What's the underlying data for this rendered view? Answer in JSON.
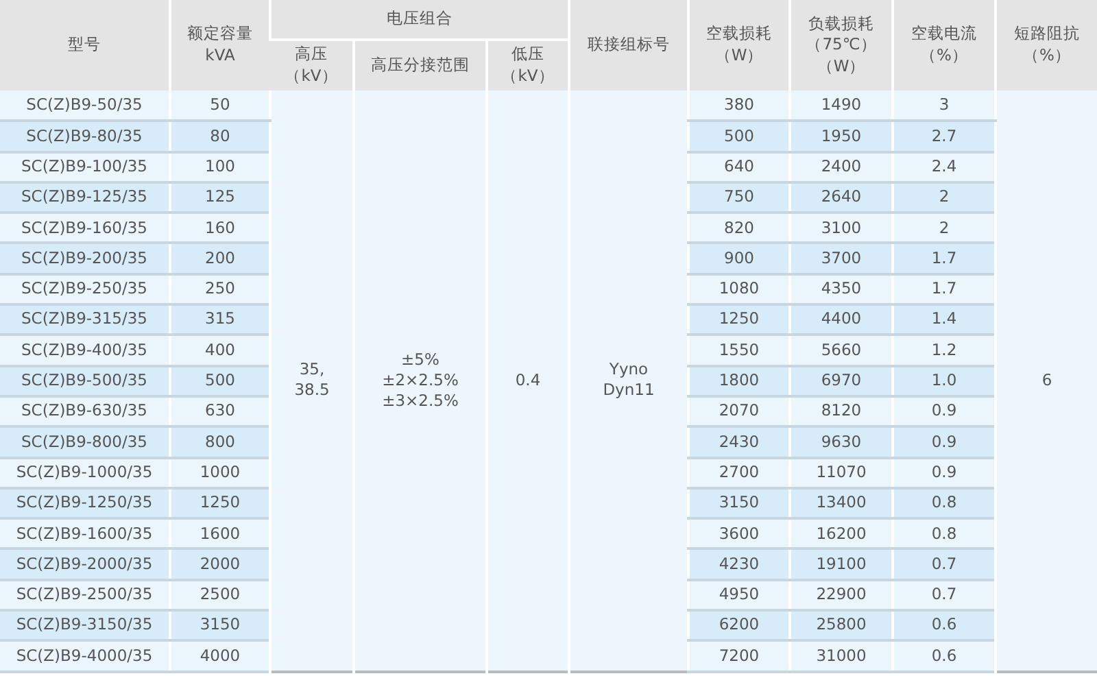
{
  "table": {
    "header": {
      "model": "型号",
      "capacity": "额定容量\nkVA",
      "voltage_group": "电压组合",
      "hv": "高压（kV）",
      "tap_range": "高压分接范围",
      "lv": "低压（kV）",
      "vector_group": "联接组标号",
      "no_load_loss": "空载损耗（W）",
      "load_loss": "负载损耗（75℃）（W）",
      "no_load_current": "空载电流（%）",
      "impedance": "短路阻抗（%）"
    },
    "merged": {
      "hv": "35,\n38.5",
      "tap_range": "±5%\n±2×2.5%\n±3×2.5%",
      "lv": "0.4",
      "vector_group": "Yyno\nDyn11",
      "impedance": "6"
    },
    "rows": [
      {
        "model": "SC(Z)B9-50/35",
        "capacity": "50",
        "no_load_loss": "380",
        "load_loss": "1490",
        "no_load_current": "3"
      },
      {
        "model": "SC(Z)B9-80/35",
        "capacity": "80",
        "no_load_loss": "500",
        "load_loss": "1950",
        "no_load_current": "2.7"
      },
      {
        "model": "SC(Z)B9-100/35",
        "capacity": "100",
        "no_load_loss": "640",
        "load_loss": "2400",
        "no_load_current": "2.4"
      },
      {
        "model": "SC(Z)B9-125/35",
        "capacity": "125",
        "no_load_loss": "750",
        "load_loss": "2640",
        "no_load_current": "2"
      },
      {
        "model": "SC(Z)B9-160/35",
        "capacity": "160",
        "no_load_loss": "820",
        "load_loss": "3100",
        "no_load_current": "2"
      },
      {
        "model": "SC(Z)B9-200/35",
        "capacity": "200",
        "no_load_loss": "900",
        "load_loss": "3700",
        "no_load_current": "1.7"
      },
      {
        "model": "SC(Z)B9-250/35",
        "capacity": "250",
        "no_load_loss": "1080",
        "load_loss": "4350",
        "no_load_current": "1.7"
      },
      {
        "model": "SC(Z)B9-315/35",
        "capacity": "315",
        "no_load_loss": "1250",
        "load_loss": "4400",
        "no_load_current": "1.4"
      },
      {
        "model": "SC(Z)B9-400/35",
        "capacity": "400",
        "no_load_loss": "1550",
        "load_loss": "5660",
        "no_load_current": "1.2"
      },
      {
        "model": "SC(Z)B9-500/35",
        "capacity": "500",
        "no_load_loss": "1800",
        "load_loss": "6970",
        "no_load_current": "1.0"
      },
      {
        "model": "SC(Z)B9-630/35",
        "capacity": "630",
        "no_load_loss": "2070",
        "load_loss": "8120",
        "no_load_current": "0.9"
      },
      {
        "model": "SC(Z)B9-800/35",
        "capacity": "800",
        "no_load_loss": "2430",
        "load_loss": "9630",
        "no_load_current": "0.9"
      },
      {
        "model": "SC(Z)B9-1000/35",
        "capacity": "1000",
        "no_load_loss": "2700",
        "load_loss": "11070",
        "no_load_current": "0.9"
      },
      {
        "model": "SC(Z)B9-1250/35",
        "capacity": "1250",
        "no_load_loss": "3150",
        "load_loss": "13400",
        "no_load_current": "0.8"
      },
      {
        "model": "SC(Z)B9-1600/35",
        "capacity": "1600",
        "no_load_loss": "3600",
        "load_loss": "16200",
        "no_load_current": "0.8"
      },
      {
        "model": "SC(Z)B9-2000/35",
        "capacity": "2000",
        "no_load_loss": "4230",
        "load_loss": "19100",
        "no_load_current": "0.7"
      },
      {
        "model": "SC(Z)B9-2500/35",
        "capacity": "2500",
        "no_load_loss": "4950",
        "load_loss": "22900",
        "no_load_current": "0.7"
      },
      {
        "model": "SC(Z)B9-3150/35",
        "capacity": "3150",
        "no_load_loss": "6200",
        "load_loss": "25800",
        "no_load_current": "0.6"
      },
      {
        "model": "SC(Z)B9-4000/35",
        "capacity": "4000",
        "no_load_loss": "7200",
        "load_loss": "31000",
        "no_load_current": "0.6"
      }
    ]
  }
}
